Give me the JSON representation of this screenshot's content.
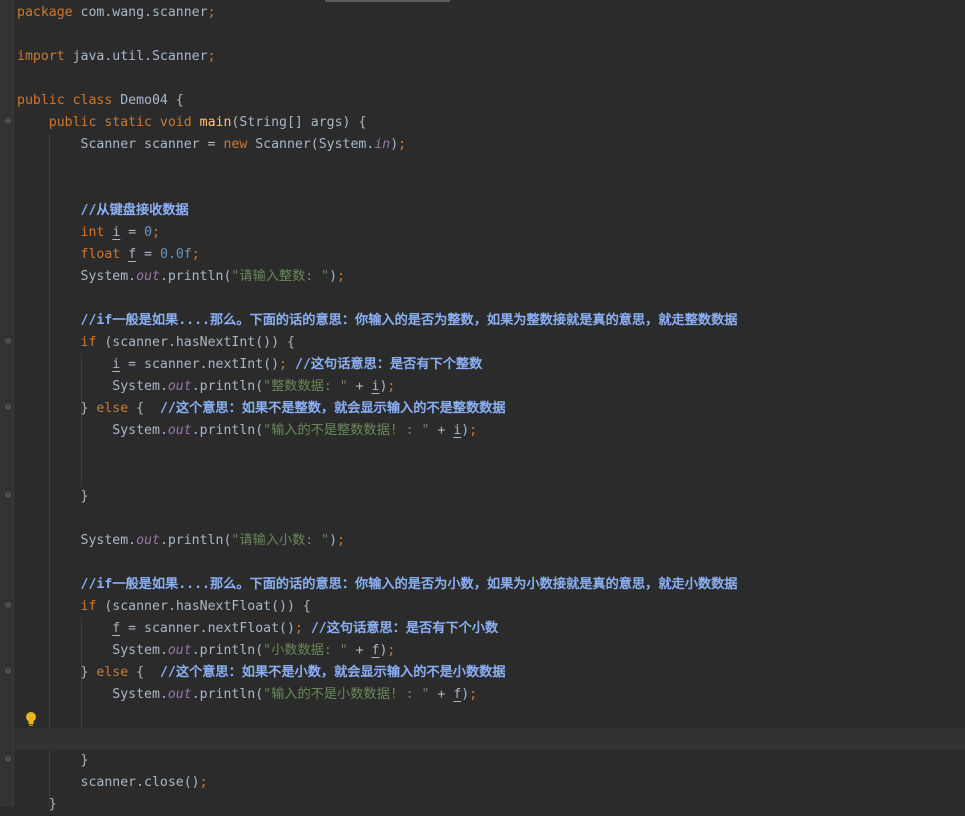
{
  "editor": {
    "colors": {
      "background": "#2b2b2b",
      "keyword": "#cc7832",
      "method_decl": "#ffc66d",
      "number": "#6897bb",
      "string": "#6a8759",
      "static_field": "#9876aa",
      "comment": "#8bb0f5",
      "default": "#a9b7c6"
    },
    "icons": {
      "intention_bulb": "lightbulb-icon",
      "fold_marker": "fold-icon"
    },
    "lines": [
      {
        "segments": [
          {
            "t": "package",
            "c": "kw"
          },
          {
            "t": " com.wang.scanner"
          },
          {
            "t": ";",
            "c": "kw"
          }
        ]
      },
      {
        "segments": []
      },
      {
        "segments": [
          {
            "t": "import",
            "c": "kw"
          },
          {
            "t": " java.util.Scanner"
          },
          {
            "t": ";",
            "c": "kw"
          }
        ]
      },
      {
        "segments": []
      },
      {
        "segments": [
          {
            "t": "public class",
            "c": "kw"
          },
          {
            "t": " Demo04 {"
          }
        ]
      },
      {
        "segments": [
          {
            "t": "    "
          },
          {
            "t": "public static void",
            "c": "kw"
          },
          {
            "t": " "
          },
          {
            "t": "main",
            "c": "fn"
          },
          {
            "t": "(String[] args) {"
          }
        ]
      },
      {
        "segments": [
          {
            "t": "        Scanner scanner = "
          },
          {
            "t": "new",
            "c": "kw"
          },
          {
            "t": " Scanner(System."
          },
          {
            "t": "in",
            "c": "sfld"
          },
          {
            "t": ")"
          },
          {
            "t": ";",
            "c": "kw"
          }
        ]
      },
      {
        "segments": []
      },
      {
        "segments": []
      },
      {
        "segments": [
          {
            "t": "        "
          },
          {
            "t": "//从键盘接收数据",
            "c": "cmt"
          }
        ]
      },
      {
        "segments": [
          {
            "t": "        "
          },
          {
            "t": "int",
            "c": "kw"
          },
          {
            "t": " "
          },
          {
            "t": "i",
            "c": "var"
          },
          {
            "t": " = "
          },
          {
            "t": "0",
            "c": "num"
          },
          {
            "t": ";",
            "c": "kw"
          }
        ]
      },
      {
        "segments": [
          {
            "t": "        "
          },
          {
            "t": "float",
            "c": "kw"
          },
          {
            "t": " "
          },
          {
            "t": "f",
            "c": "var"
          },
          {
            "t": " = "
          },
          {
            "t": "0.0f",
            "c": "num"
          },
          {
            "t": ";",
            "c": "kw"
          }
        ]
      },
      {
        "segments": [
          {
            "t": "        System."
          },
          {
            "t": "out",
            "c": "sfld"
          },
          {
            "t": ".println("
          },
          {
            "t": "\"请输入整数: \"",
            "c": "str"
          },
          {
            "t": ")"
          },
          {
            "t": ";",
            "c": "kw"
          }
        ]
      },
      {
        "segments": []
      },
      {
        "segments": [
          {
            "t": "        "
          },
          {
            "t": "//if一般是如果....那么。下面的话的意思：你输入的是否为整数，如果为整数接就是真的意思，就走整数数据",
            "c": "cmt"
          }
        ]
      },
      {
        "segments": [
          {
            "t": "        "
          },
          {
            "t": "if",
            "c": "kw"
          },
          {
            "t": " (scanner.hasNextInt()) {"
          }
        ]
      },
      {
        "segments": [
          {
            "t": "            "
          },
          {
            "t": "i",
            "c": "var"
          },
          {
            "t": " = scanner.nextInt()"
          },
          {
            "t": ";",
            "c": "kw"
          },
          {
            "t": " "
          },
          {
            "t": "//这句话意思：是否有下个整数",
            "c": "cmt"
          }
        ]
      },
      {
        "segments": [
          {
            "t": "            System."
          },
          {
            "t": "out",
            "c": "sfld"
          },
          {
            "t": ".println("
          },
          {
            "t": "\"整数数据: \"",
            "c": "str"
          },
          {
            "t": " + "
          },
          {
            "t": "i",
            "c": "var"
          },
          {
            "t": ")"
          },
          {
            "t": ";",
            "c": "kw"
          }
        ]
      },
      {
        "segments": [
          {
            "t": "        } "
          },
          {
            "t": "else",
            "c": "kw"
          },
          {
            "t": " {  "
          },
          {
            "t": "//这个意思：如果不是整数，就会显示输入的不是整数数据",
            "c": "cmt"
          }
        ]
      },
      {
        "segments": [
          {
            "t": "            System."
          },
          {
            "t": "out",
            "c": "sfld"
          },
          {
            "t": ".println("
          },
          {
            "t": "\"输入的不是整数数据! : \"",
            "c": "str"
          },
          {
            "t": " + "
          },
          {
            "t": "i",
            "c": "var"
          },
          {
            "t": ")"
          },
          {
            "t": ";",
            "c": "kw"
          }
        ]
      },
      {
        "segments": []
      },
      {
        "segments": []
      },
      {
        "segments": [
          {
            "t": "        }"
          }
        ]
      },
      {
        "segments": []
      },
      {
        "segments": [
          {
            "t": "        System."
          },
          {
            "t": "out",
            "c": "sfld"
          },
          {
            "t": ".println("
          },
          {
            "t": "\"请输入小数: \"",
            "c": "str"
          },
          {
            "t": ")"
          },
          {
            "t": ";",
            "c": "kw"
          }
        ]
      },
      {
        "segments": []
      },
      {
        "segments": [
          {
            "t": "        "
          },
          {
            "t": "//if一般是如果....那么。下面的话的意思：你输入的是否为小数，如果为小数接就是真的意思，就走小数数据",
            "c": "cmt"
          }
        ]
      },
      {
        "segments": [
          {
            "t": "        "
          },
          {
            "t": "if",
            "c": "kw"
          },
          {
            "t": " (scanner.hasNextFloat()) {"
          }
        ]
      },
      {
        "segments": [
          {
            "t": "            "
          },
          {
            "t": "f",
            "c": "var"
          },
          {
            "t": " = scanner.nextFloat()"
          },
          {
            "t": ";",
            "c": "kw"
          },
          {
            "t": " "
          },
          {
            "t": "//这句话意思：是否有下个小数",
            "c": "cmt"
          }
        ]
      },
      {
        "segments": [
          {
            "t": "            System."
          },
          {
            "t": "out",
            "c": "sfld"
          },
          {
            "t": ".println("
          },
          {
            "t": "\"小数数据: \"",
            "c": "str"
          },
          {
            "t": " + "
          },
          {
            "t": "f",
            "c": "var"
          },
          {
            "t": ")"
          },
          {
            "t": ";",
            "c": "kw"
          }
        ]
      },
      {
        "segments": [
          {
            "t": "        } "
          },
          {
            "t": "else",
            "c": "kw"
          },
          {
            "t": " {  "
          },
          {
            "t": "//这个意思：如果不是小数，就会显示输入的不是小数数据",
            "c": "cmt"
          }
        ]
      },
      {
        "segments": [
          {
            "t": "            System."
          },
          {
            "t": "out",
            "c": "sfld"
          },
          {
            "t": ".println("
          },
          {
            "t": "\"输入的不是小数数据! : \"",
            "c": "str"
          },
          {
            "t": " + "
          },
          {
            "t": "f",
            "c": "var"
          },
          {
            "t": ")"
          },
          {
            "t": ";",
            "c": "kw"
          }
        ]
      },
      {
        "segments": []
      },
      {
        "segments": []
      },
      {
        "segments": [
          {
            "t": "        }"
          }
        ]
      },
      {
        "segments": [
          {
            "t": "        scanner.close()"
          },
          {
            "t": ";",
            "c": "kw"
          }
        ]
      },
      {
        "segments": [
          {
            "t": "    }"
          }
        ]
      }
    ]
  }
}
